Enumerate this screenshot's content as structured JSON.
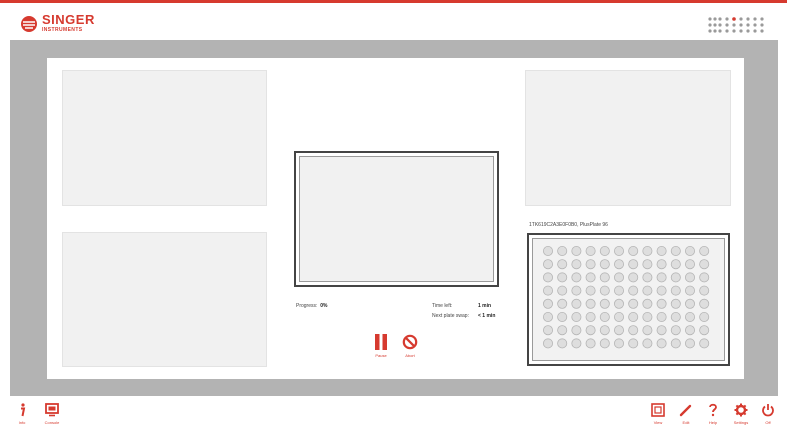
{
  "brand": {
    "name": "SINGER",
    "sub": "INSTRUMENTS",
    "accent": "#d63a2f"
  },
  "status": {
    "progress_label": "Progress:",
    "progress_value": "0%",
    "time_left_label": "Time left:",
    "time_left_value": "1 min",
    "next_swap_label": "Next plate swap:",
    "next_swap_value": "< 1 min"
  },
  "plate": {
    "label": "1TK619C2A3E0F0B0, PlusPlate 96",
    "rows": 8,
    "cols": 12
  },
  "controls": {
    "pause_label": "Pause",
    "abort_label": "Abort"
  },
  "footer": {
    "info_label": "Info",
    "console_label": "Console",
    "view_label": "View",
    "edit_label": "Edit",
    "help_label": "Help",
    "settings_label": "Settings",
    "off_label": "Off"
  },
  "icons": [
    "singer-logo-icon",
    "grid-dots-icon",
    "pause-icon",
    "abort-icon",
    "info-icon",
    "console-icon",
    "view-icon",
    "edit-icon",
    "help-icon",
    "settings-icon",
    "power-icon"
  ]
}
